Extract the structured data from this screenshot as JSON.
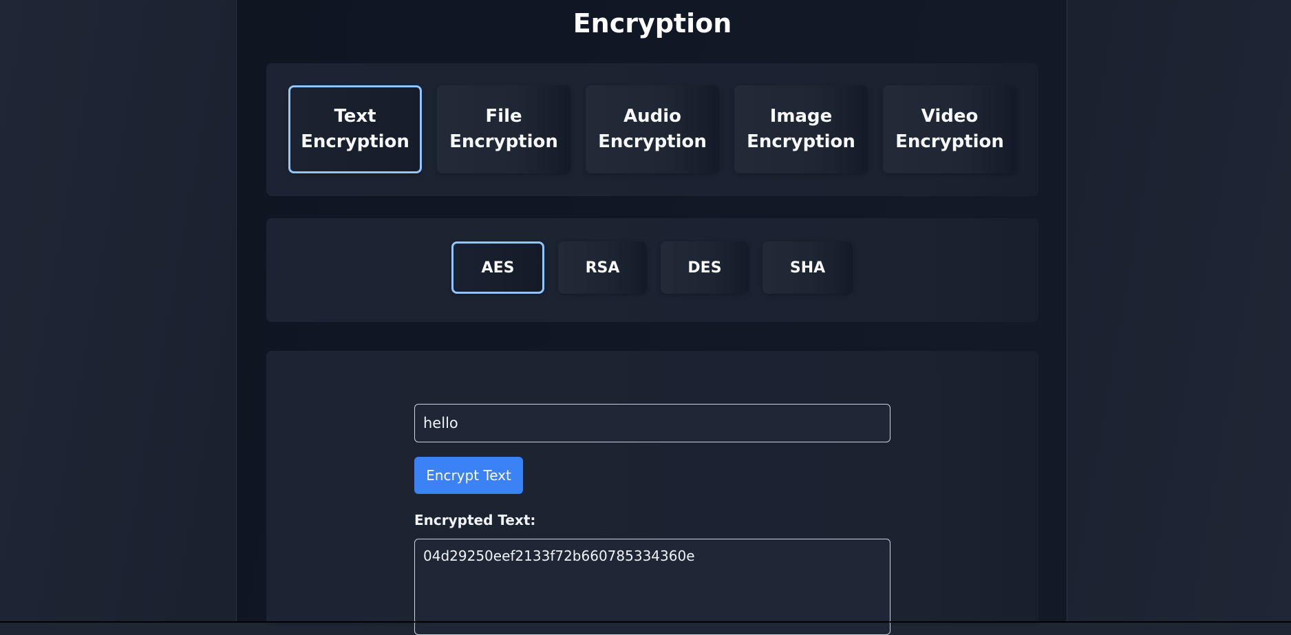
{
  "page": {
    "title": "Encryption"
  },
  "encryption_types": [
    {
      "label": "Text\nEncryption",
      "active": true
    },
    {
      "label": "File\nEncryption",
      "active": false
    },
    {
      "label": "Audio\nEncryption",
      "active": false
    },
    {
      "label": "Image\nEncryption",
      "active": false
    },
    {
      "label": "Video\nEncryption",
      "active": false
    }
  ],
  "algorithms": [
    {
      "label": "AES",
      "active": true
    },
    {
      "label": "RSA",
      "active": false
    },
    {
      "label": "DES",
      "active": false
    },
    {
      "label": "SHA",
      "active": false
    }
  ],
  "workspace": {
    "input_value": "hello",
    "encrypt_button_label": "Encrypt Text",
    "result_label": "Encrypted Text:",
    "result_value": "04d29250eef2133f72b660785334360e"
  },
  "colors": {
    "accent": "#3b82f6",
    "active_border": "#93c5fd",
    "background": "#111826"
  }
}
